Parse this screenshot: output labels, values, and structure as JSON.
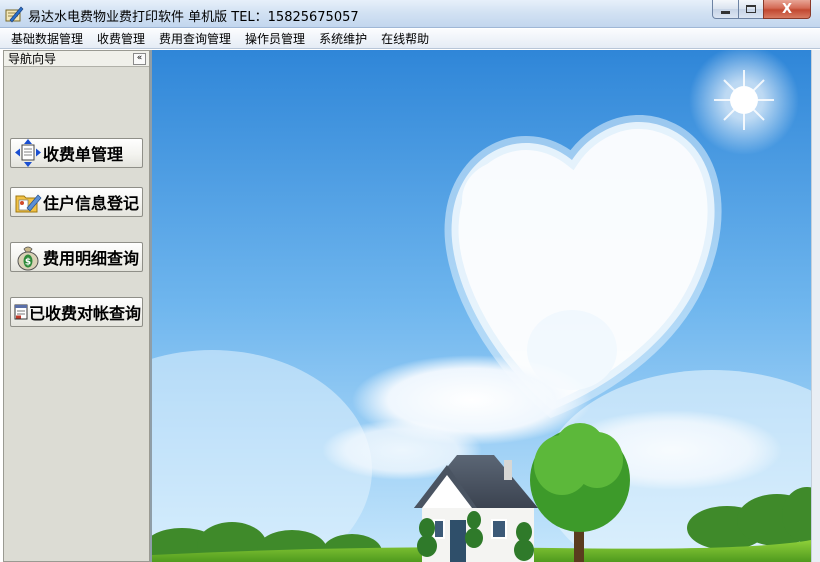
{
  "window": {
    "title": "易达水电费物业费打印软件  单机版  TEL：15825675057",
    "controls": {
      "minimize": "",
      "maximize": "",
      "close": "X"
    }
  },
  "menu": {
    "items": [
      "基础数据管理",
      "收费管理",
      "费用查询管理",
      "操作员管理",
      "系统维护",
      "在线帮助"
    ]
  },
  "nav": {
    "title": "导航向导",
    "collapse_label": "«",
    "buttons": [
      {
        "label": "收费单管理",
        "icon": "document-arrows-icon"
      },
      {
        "label": "住户信息登记",
        "icon": "folder-edit-icon"
      },
      {
        "label": "费用明细查询",
        "icon": "money-bag-icon"
      },
      {
        "label": "已收费对帐查询",
        "icon": "receipt-icon"
      }
    ]
  },
  "colors": {
    "sky_top": "#2f86d8",
    "sky_bottom": "#bfe3fb",
    "grass": "#6fbd2a",
    "nav_bg": "#dcdcd4"
  }
}
